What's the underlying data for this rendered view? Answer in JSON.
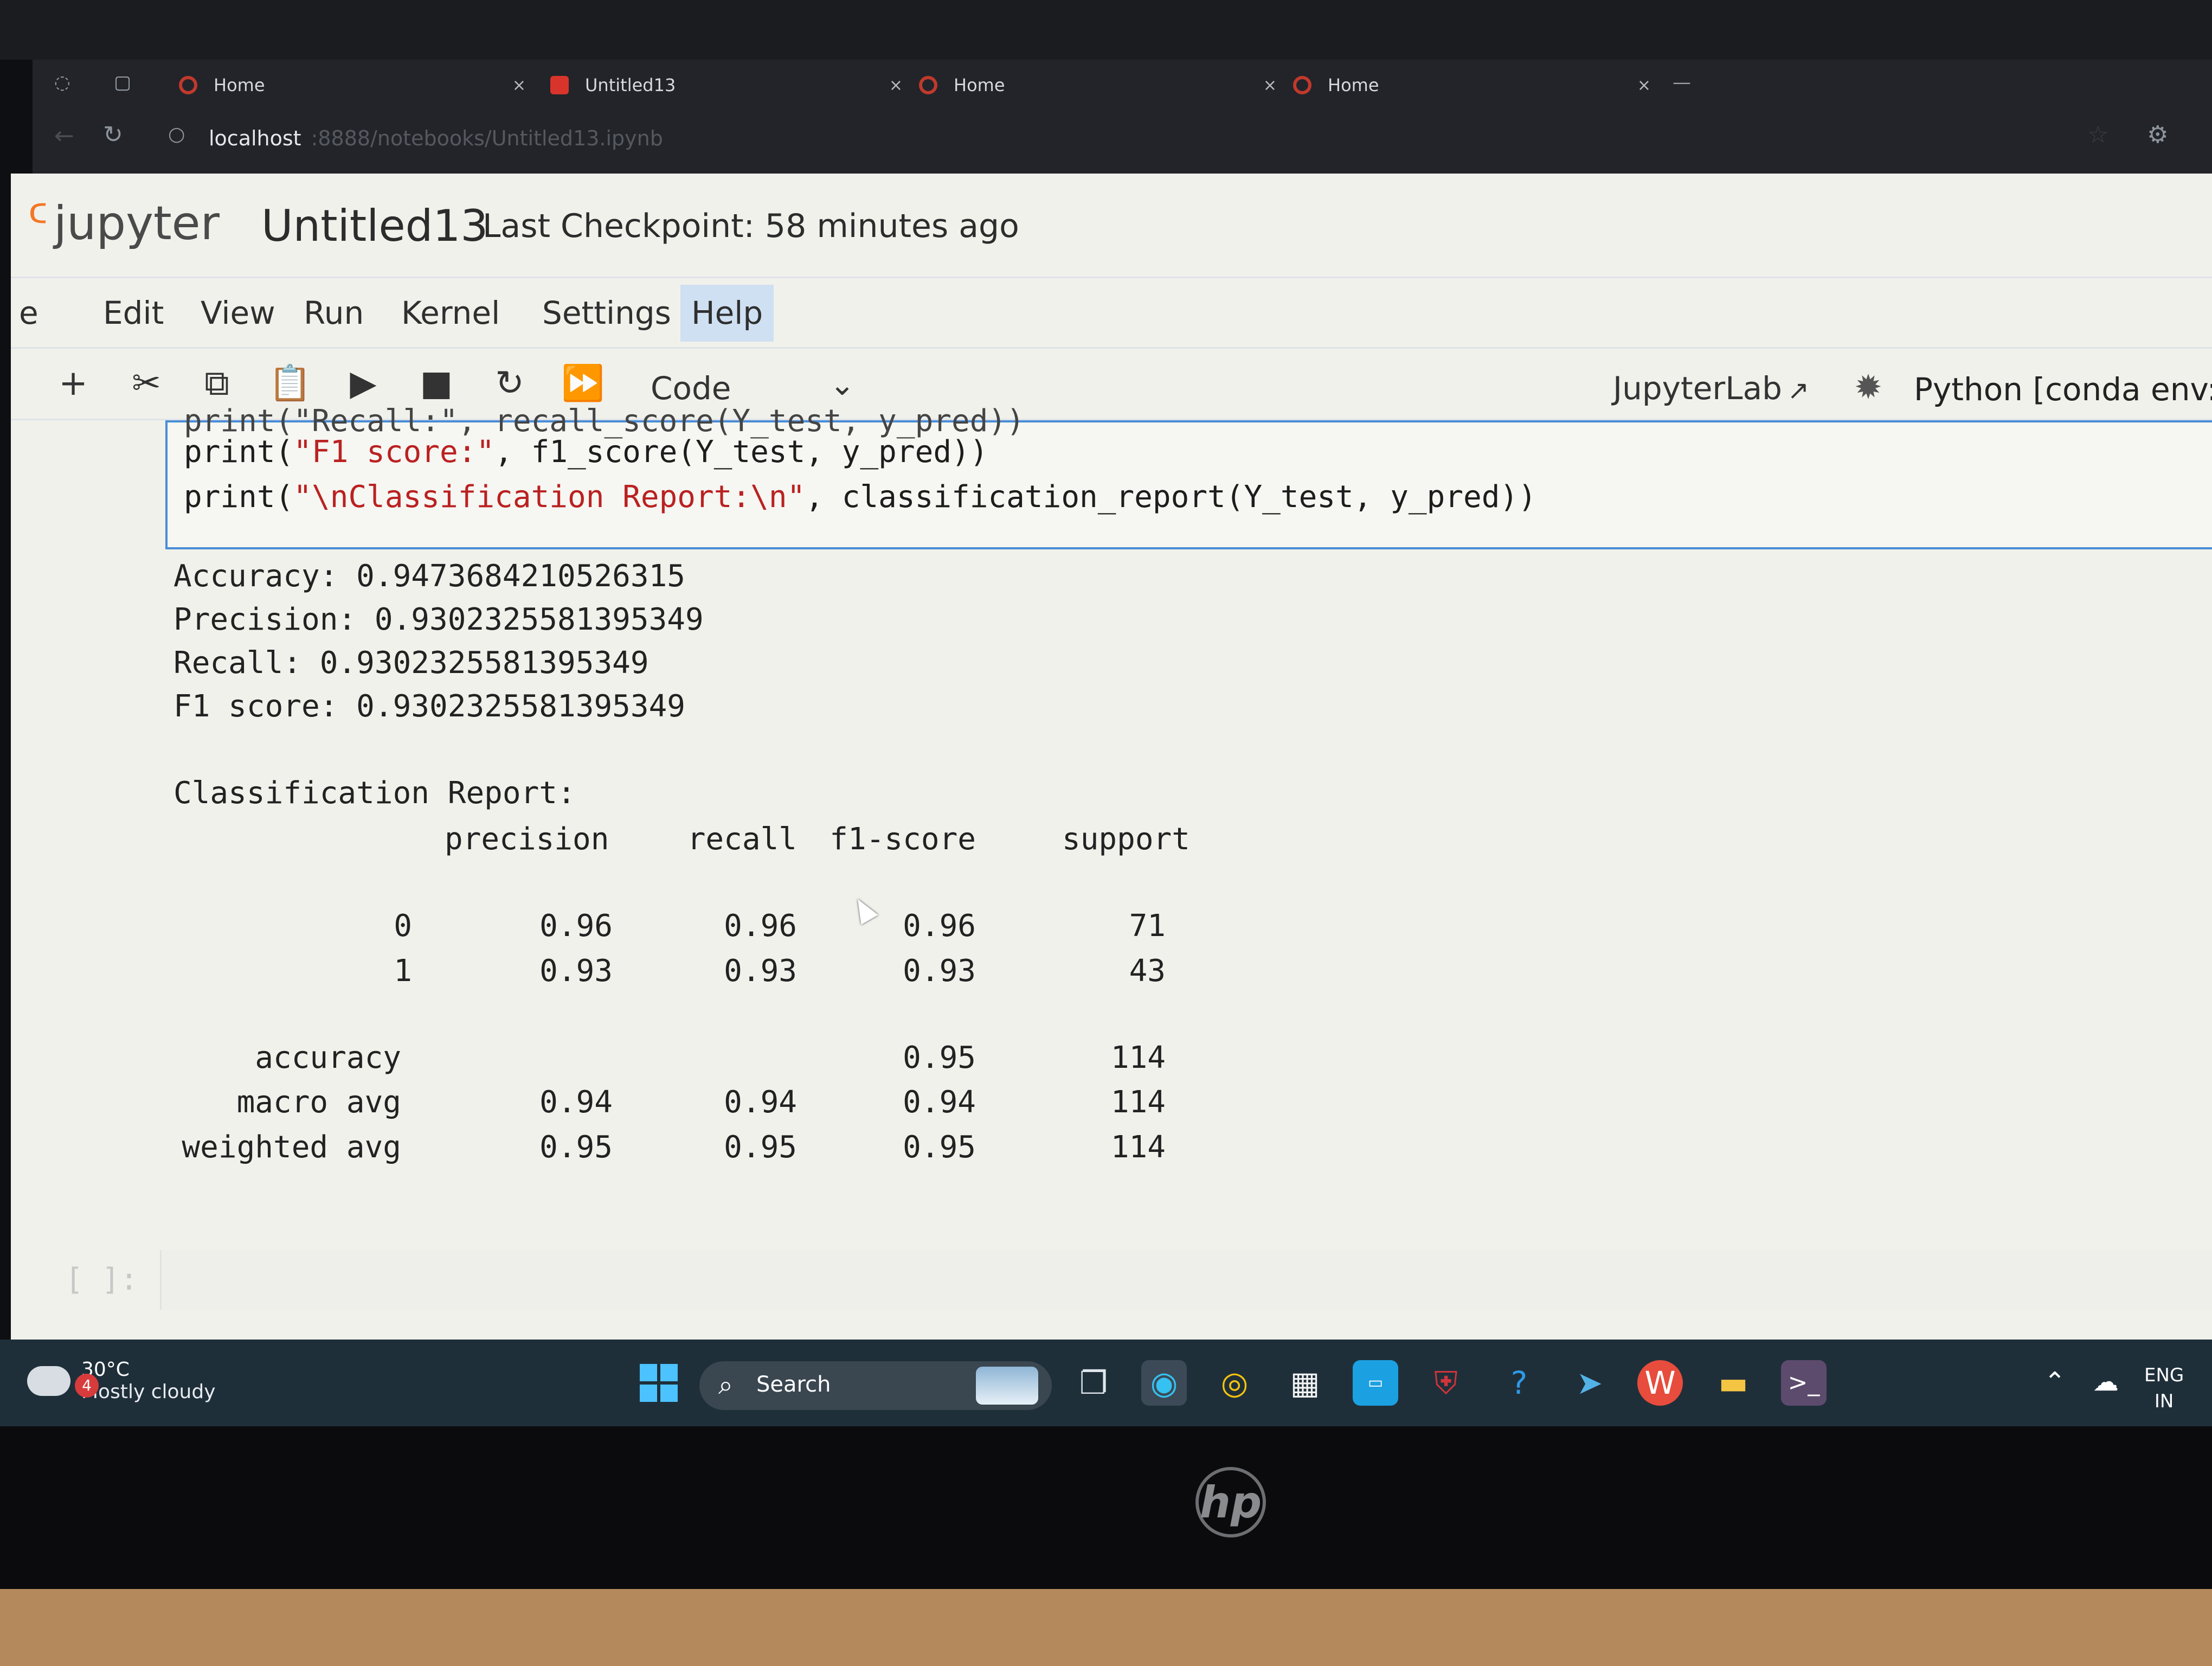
{
  "browser": {
    "tabs": [
      {
        "title": "Home"
      },
      {
        "title": "Untitled13"
      },
      {
        "title": "Home"
      },
      {
        "title": "Home"
      }
    ],
    "close_glyph": "×",
    "minimize_glyph": "—",
    "url_host": "localhost",
    "url_path": ":8888/notebooks/Untitled13.ipynb"
  },
  "header": {
    "logo_text": "jupyter",
    "notebook_title": "Untitled13",
    "checkpoint": "Last Checkpoint: 58 minutes ago"
  },
  "menu": {
    "items": [
      "e",
      "Edit",
      "View",
      "Run",
      "Kernel",
      "Settings",
      "Help"
    ],
    "active": "Help"
  },
  "toolbar": {
    "cell_type": "Code",
    "jupyterlab_label": "JupyterLab",
    "kernel_label": "Python [conda env:ar"
  },
  "code_cell": {
    "partial_line": "print(\"Recall:\", recall_score(Y_test, y_pred))",
    "line2_prefix": "print(",
    "line2_string": "\"F1 score:\"",
    "line2_suffix": ", f1_score(Y_test, y_pred))",
    "line3_prefix": "print(",
    "line3_string": "\"\\nClassification Report:\\n\"",
    "line3_suffix": ", classification_report(Y_test, y_pred))"
  },
  "output": {
    "metrics": [
      "Accuracy: 0.9473684210526315",
      "Precision: 0.9302325581395349",
      "Recall: 0.9302325581395349",
      "F1 score: 0.9302325581395349"
    ],
    "report_title": "Classification Report:",
    "report_columns": [
      "precision",
      "recall",
      "f1-score",
      "support"
    ],
    "report_rows": [
      {
        "label": "0",
        "precision": "0.96",
        "recall": "0.96",
        "f1": "0.96",
        "support": "71"
      },
      {
        "label": "1",
        "precision": "0.93",
        "recall": "0.93",
        "f1": "0.93",
        "support": "43"
      },
      {
        "label": "accuracy",
        "precision": "",
        "recall": "",
        "f1": "0.95",
        "support": "114"
      },
      {
        "label": "macro avg",
        "precision": "0.94",
        "recall": "0.94",
        "f1": "0.94",
        "support": "114"
      },
      {
        "label": "weighted avg",
        "precision": "0.95",
        "recall": "0.95",
        "f1": "0.95",
        "support": "114"
      }
    ]
  },
  "empty_cell": {
    "prompt": "[ ]:"
  },
  "taskbar": {
    "weather_badge": "4",
    "temperature": "30°C",
    "condition": "Mostly cloudy",
    "search_label": "Search",
    "lang_line1": "ENG",
    "lang_line2": "IN"
  },
  "laptop": {
    "brand": "hp"
  },
  "colors": {
    "accent_blue": "#4a8cd6",
    "string_red": "#ba2121",
    "jupyter_orange": "#f37726",
    "active_menu_bg": "#cfe0f2"
  }
}
